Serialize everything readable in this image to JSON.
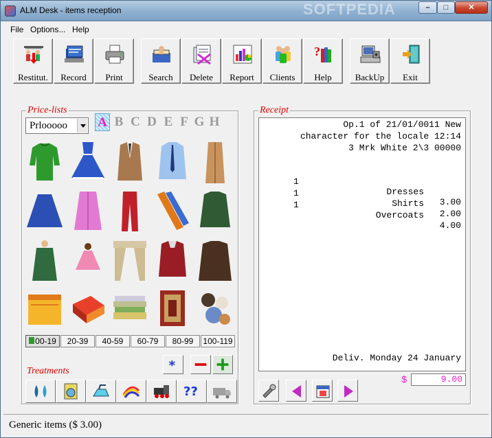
{
  "window": {
    "title": "ALM Desk - items reception",
    "watermark": "SOFTPEDIA"
  },
  "menu": [
    {
      "label": "File"
    },
    {
      "label": "Options..."
    },
    {
      "label": "Help"
    }
  ],
  "toolbar": [
    {
      "label": "Restitut.",
      "icon": "restitution-icon"
    },
    {
      "label": "Record",
      "icon": "record-icon"
    },
    {
      "label": "Print",
      "icon": "printer-icon"
    },
    {
      "label": "Search",
      "icon": "search-icon"
    },
    {
      "label": "Delete",
      "icon": "delete-icon"
    },
    {
      "label": "Report",
      "icon": "report-chart-icon"
    },
    {
      "label": "Clients",
      "icon": "clients-icon"
    },
    {
      "label": "Help",
      "icon": "help-books-icon"
    },
    {
      "label": "BackUp",
      "icon": "backup-computer-icon"
    },
    {
      "label": "Exit",
      "icon": "exit-door-icon"
    }
  ],
  "pricelists": {
    "title": "Price-lists",
    "selected": "Prlooooo",
    "letters": [
      "A",
      "B",
      "C",
      "D",
      "E",
      "F",
      "G",
      "H"
    ],
    "active_letter": "A",
    "items": [
      "sweater-icon",
      "dress-icon",
      "jacket-icon",
      "shirt-icon",
      "overcoat-icon",
      "skirt-icon",
      "robe-icon",
      "trousers-icon",
      "ties-icon",
      "parka-icon",
      "raincoat-icon",
      "child-dress-icon",
      "curtain-icon",
      "winter-jacket-icon",
      "leather-coat-icon",
      "quilt-icon",
      "blanket-icon",
      "linen-stack-icon",
      "rug-icon",
      "soft-toys-icon"
    ],
    "ranges": [
      "00-19",
      "20-39",
      "40-59",
      "60-79",
      "80-99",
      "100-119"
    ],
    "active_range": "00-19"
  },
  "treatments": {
    "title": "Treatments",
    "buttons": [
      "drops-icon",
      "washing-machine-icon",
      "iron-icon",
      "dye-icon",
      "train-icon",
      "question-icon",
      "delivery-truck-icon"
    ],
    "question_label": "??"
  },
  "receipt": {
    "title": "Receipt",
    "header": [
      "Op.1 of 21/01/0011 New",
      "character for the locale 12:14",
      "3 Mrk White 2\\3 00000"
    ],
    "lines": [
      {
        "qty": "1",
        "item": "Dresses",
        "price": "3.00"
      },
      {
        "qty": "1",
        "item": "Shirts",
        "price": "2.00"
      },
      {
        "qty": "1",
        "item": "Overcoats",
        "price": "4.00"
      }
    ],
    "delivery": "Deliv. Monday 24 January",
    "currency": "$",
    "total": "9.00"
  },
  "status": "Generic items ($ 3.00)",
  "colors": {
    "accent_red": "#d00000",
    "accent_magenta": "#e81ec8",
    "title_bar": "#8fb0d0"
  }
}
